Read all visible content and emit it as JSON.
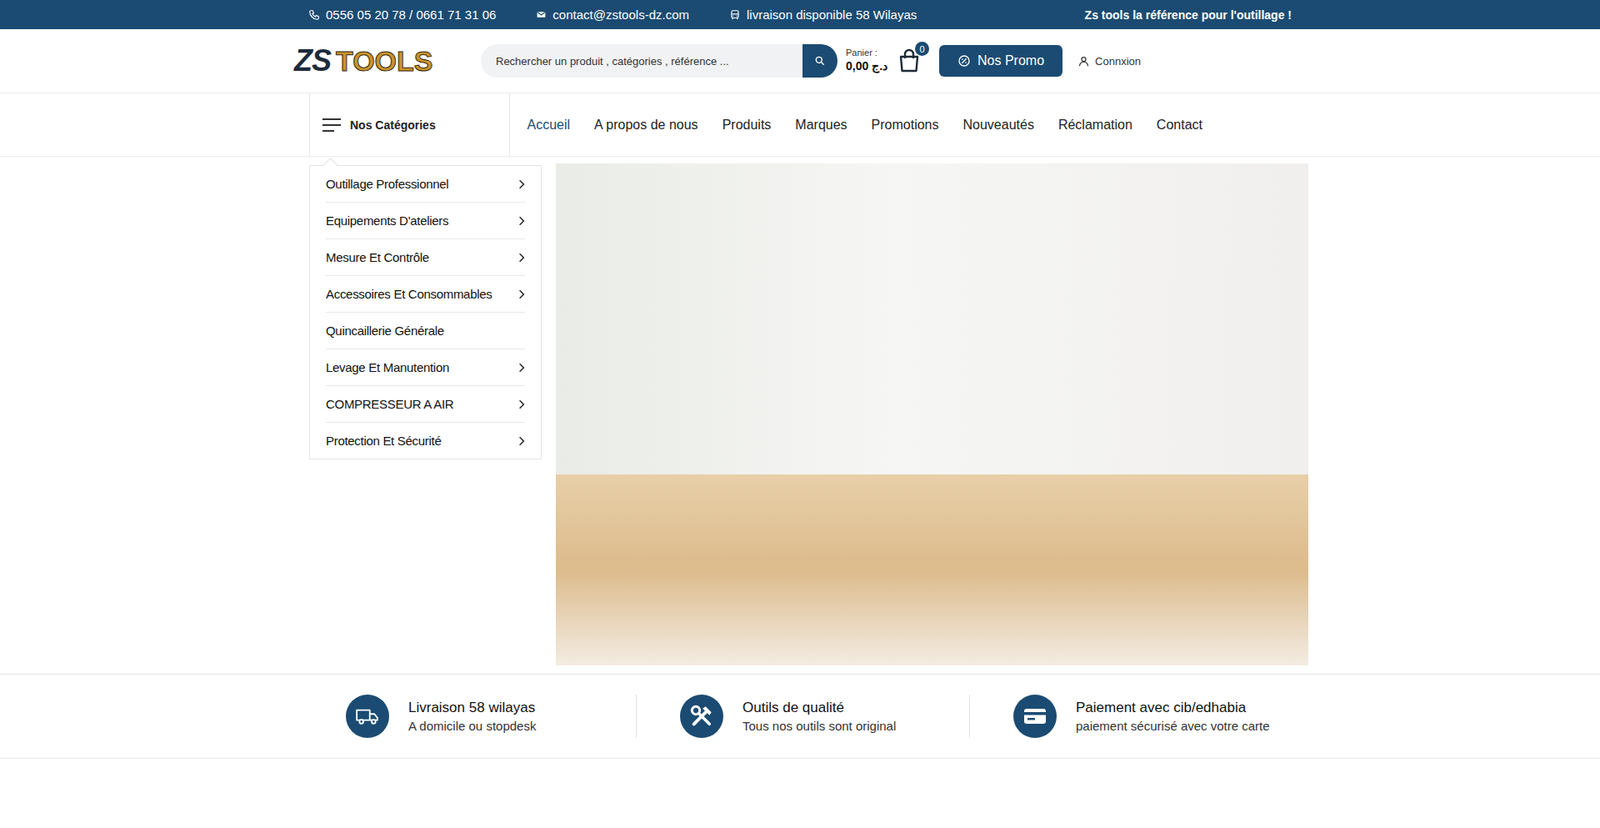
{
  "topbar": {
    "phone": "0556 05 20 78 / 0661 71 31 06",
    "email": "contact@zstools-dz.com",
    "delivery": "livraison disponible 58 Wilayas",
    "slogan": "Zs tools la référence pour l'outillage !"
  },
  "logo": {
    "part1": "ZS",
    "part2": "TOOLS"
  },
  "search": {
    "placeholder": "Rechercher un produit , catégories , référence ..."
  },
  "cart": {
    "label": "Panier :",
    "total": "0,00 د.ج",
    "count": "0"
  },
  "promo_button": "Nos Promo",
  "login": "Connxion",
  "categories_button": "Nos Catégories",
  "nav": [
    {
      "label": "Accueil",
      "selected": true
    },
    {
      "label": "A propos de nous",
      "selected": false
    },
    {
      "label": "Produits",
      "selected": false
    },
    {
      "label": "Marques",
      "selected": false
    },
    {
      "label": "Promotions",
      "selected": false
    },
    {
      "label": "Nouveautés",
      "selected": false
    },
    {
      "label": "Réclamation",
      "selected": false
    },
    {
      "label": "Contact",
      "selected": false
    }
  ],
  "categories": [
    {
      "label": "Outillage Professionnel",
      "has_submenu": true
    },
    {
      "label": "Equipements D'ateliers",
      "has_submenu": true
    },
    {
      "label": "Mesure Et Contrôle",
      "has_submenu": true
    },
    {
      "label": "Accessoires Et Consommables",
      "has_submenu": true
    },
    {
      "label": "Quincaillerie Générale",
      "has_submenu": false
    },
    {
      "label": "Levage Et Manutention",
      "has_submenu": true
    },
    {
      "label": "COMPRESSEUR A AIR",
      "has_submenu": true
    },
    {
      "label": "Protection Et Sécurité",
      "has_submenu": true
    }
  ],
  "features": [
    {
      "title": "Livraison 58 wilayas",
      "subtitle": "A domicile ou stopdesk"
    },
    {
      "title": "Outils de qualité",
      "subtitle": "Tous nos outils sont original"
    },
    {
      "title": "Paiement avec cib/edhabia",
      "subtitle": "paiement sécurisé avec votre carte"
    }
  ]
}
